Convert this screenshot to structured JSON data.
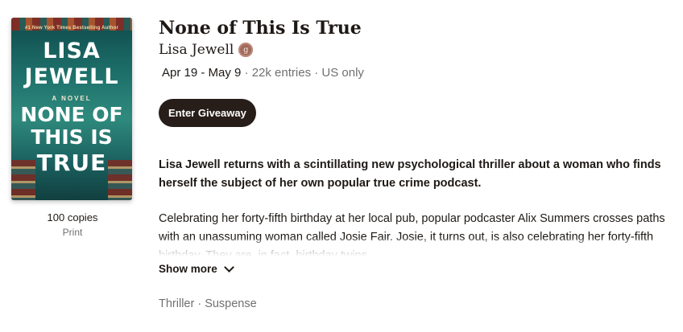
{
  "cover": {
    "bestseller": "#1 New York Times Bestselling Author",
    "author_line1": "LISA",
    "author_line2": "JEWELL",
    "novel_label": "A NOVEL",
    "title_line1": "NONE OF",
    "title_line2": "THIS IS",
    "title_line3": "TRUE"
  },
  "giveaway": {
    "copies": "100 copies",
    "format": "Print",
    "book_title": "None of This Is True",
    "author": "Lisa Jewell",
    "author_badge": "g",
    "dates": "Apr 19 - May 9",
    "meta_rest": " · 22k entries · US only",
    "enter_label": "Enter Giveaway",
    "description_bold": "Lisa Jewell returns with a scintillating new psychological thriller about a woman who finds herself the subject of her own popular true crime podcast.",
    "description": "Celebrating her forty-fifth birthday at her local pub, popular podcaster Alix Summers crosses paths with an unassuming woman called Josie Fair. Josie, it turns out, is also celebrating her forty-fifth birthday. They are, in fact, birthday twins.",
    "show_more_label": "Show more",
    "genres": "Thriller · Suspense"
  },
  "colors": {
    "button_bg": "#271e1a",
    "muted_text": "#707070",
    "badge": "#a06a5c"
  }
}
